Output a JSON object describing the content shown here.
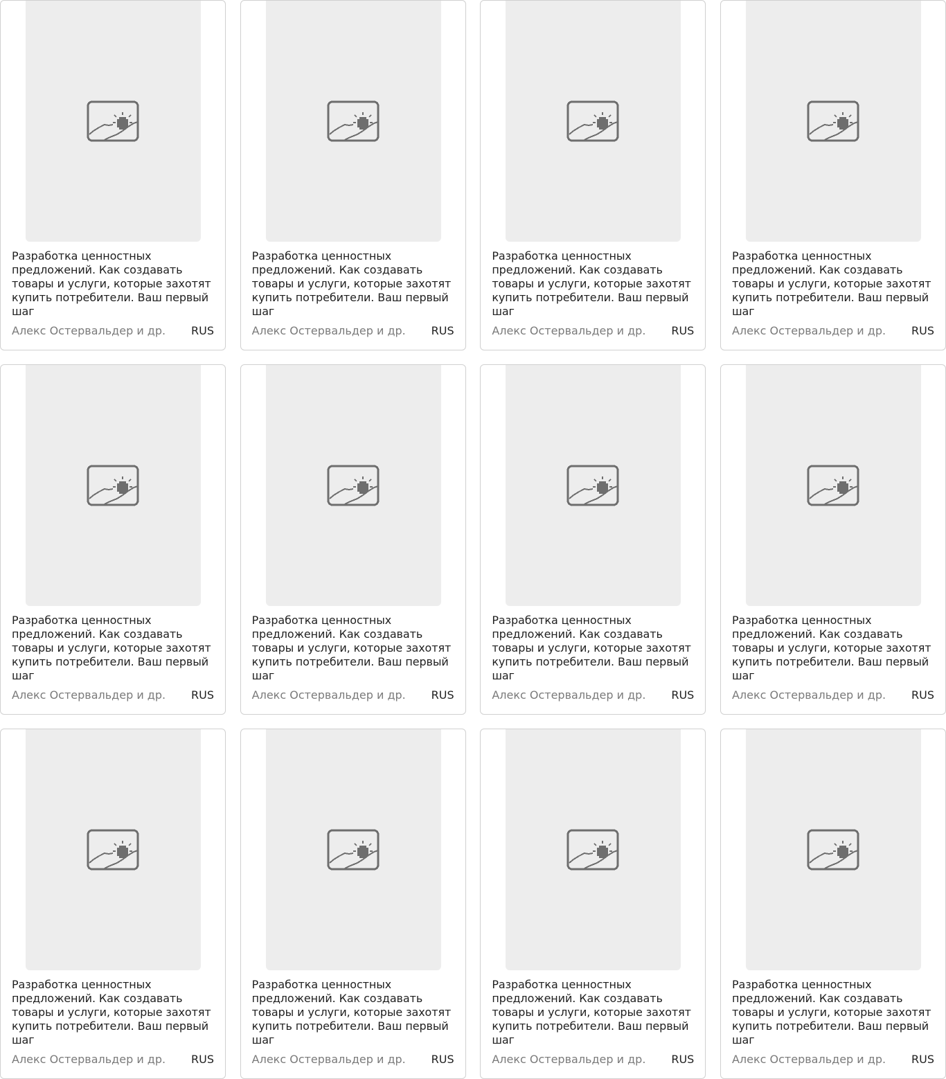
{
  "colors": {
    "card_border": "#d0d0d0",
    "cover_placeholder": "#ededed",
    "icon": "#6e6e6e",
    "title_text": "#1f1f1f",
    "author_text": "#7a7a7a"
  },
  "books": [
    {
      "title": "Разработка ценностных предложений. Как создавать товары и услуги, которые захотят купить потребители. Ваш первый шаг",
      "author": "Алекс Остервальдер и др.",
      "language": "RUS",
      "cover_icon": "image-placeholder-icon"
    },
    {
      "title": "Разработка ценностных предложений. Как создавать товары и услуги, которые захотят купить потребители. Ваш первый шаг",
      "author": "Алекс Остервальдер и др.",
      "language": "RUS",
      "cover_icon": "image-placeholder-icon"
    },
    {
      "title": "Разработка ценностных предложений. Как создавать товары и услуги, которые захотят купить потребители. Ваш первый шаг",
      "author": "Алекс Остервальдер и др.",
      "language": "RUS",
      "cover_icon": "image-placeholder-icon"
    },
    {
      "title": "Разработка ценностных предложений. Как создавать товары и услуги, которые захотят купить потребители. Ваш первый шаг",
      "author": "Алекс Остервальдер и др.",
      "language": "RUS",
      "cover_icon": "image-placeholder-icon"
    },
    {
      "title": "Разработка ценностных предложений. Как создавать товары и услуги, которые захотят купить потребители. Ваш первый шаг",
      "author": "Алекс Остервальдер и др.",
      "language": "RUS",
      "cover_icon": "image-placeholder-icon"
    },
    {
      "title": "Разработка ценностных предложений. Как создавать товары и услуги, которые захотят купить потребители. Ваш первый шаг",
      "author": "Алекс Остервальдер и др.",
      "language": "RUS",
      "cover_icon": "image-placeholder-icon"
    },
    {
      "title": "Разработка ценностных предложений. Как создавать товары и услуги, которые захотят купить потребители. Ваш первый шаг",
      "author": "Алекс Остервальдер и др.",
      "language": "RUS",
      "cover_icon": "image-placeholder-icon"
    },
    {
      "title": "Разработка ценностных предложений. Как создавать товары и услуги, которые захотят купить потребители. Ваш первый шаг",
      "author": "Алекс Остервальдер и др.",
      "language": "RUS",
      "cover_icon": "image-placeholder-icon"
    },
    {
      "title": "Разработка ценностных предложений. Как создавать товары и услуги, которые захотят купить потребители. Ваш первый шаг",
      "author": "Алекс Остервальдер и др.",
      "language": "RUS",
      "cover_icon": "image-placeholder-icon"
    },
    {
      "title": "Разработка ценностных предложений. Как создавать товары и услуги, которые захотят купить потребители. Ваш первый шаг",
      "author": "Алекс Остервальдер и др.",
      "language": "RUS",
      "cover_icon": "image-placeholder-icon"
    },
    {
      "title": "Разработка ценностных предложений. Как создавать товары и услуги, которые захотят купить потребители. Ваш первый шаг",
      "author": "Алекс Остервальдер и др.",
      "language": "RUS",
      "cover_icon": "image-placeholder-icon"
    },
    {
      "title": "Разработка ценностных предложений. Как создавать товары и услуги, которые захотят купить потребители. Ваш первый шаг",
      "author": "Алекс Остервальдер и др.",
      "language": "RUS",
      "cover_icon": "image-placeholder-icon"
    }
  ]
}
